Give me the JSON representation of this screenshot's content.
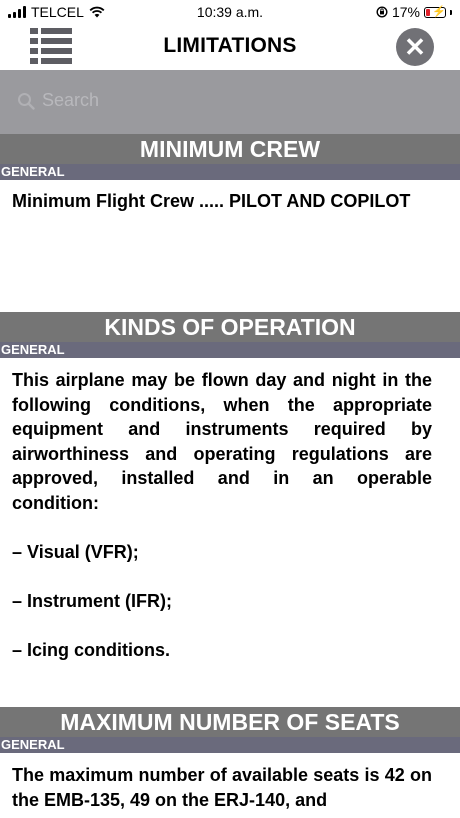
{
  "status_bar": {
    "carrier": "TELCEL",
    "time": "10:39 a.m.",
    "battery": "17%"
  },
  "nav": {
    "title": "LIMITATIONS"
  },
  "search": {
    "placeholder": "Search"
  },
  "sections": [
    {
      "title": "MINIMUM CREW",
      "category": "GENERAL",
      "text": "Minimum Flight Crew ..... PILOT AND COPILOT"
    },
    {
      "title": "KINDS OF OPERATION",
      "category": "GENERAL",
      "text": "This airplane may be flown day and night in the following conditions, when the appropriate equipment and instruments required by airworthiness and operating regulations are approved, installed and in an operable condition:",
      "items": [
        "– Visual (VFR);",
        "– Instrument (IFR);",
        "– Icing conditions."
      ]
    },
    {
      "title": "MAXIMUM NUMBER OF SEATS",
      "category": "GENERAL",
      "text": "The maximum number of available seats is 42 on the EMB-135, 49 on the ERJ-140, and"
    }
  ],
  "colors": {
    "section_header": "#757575",
    "category_bar": "#6a6a7c",
    "search_bar": "#9a9a9e",
    "close_button": "#717176",
    "battery_low": "#e0202a"
  }
}
